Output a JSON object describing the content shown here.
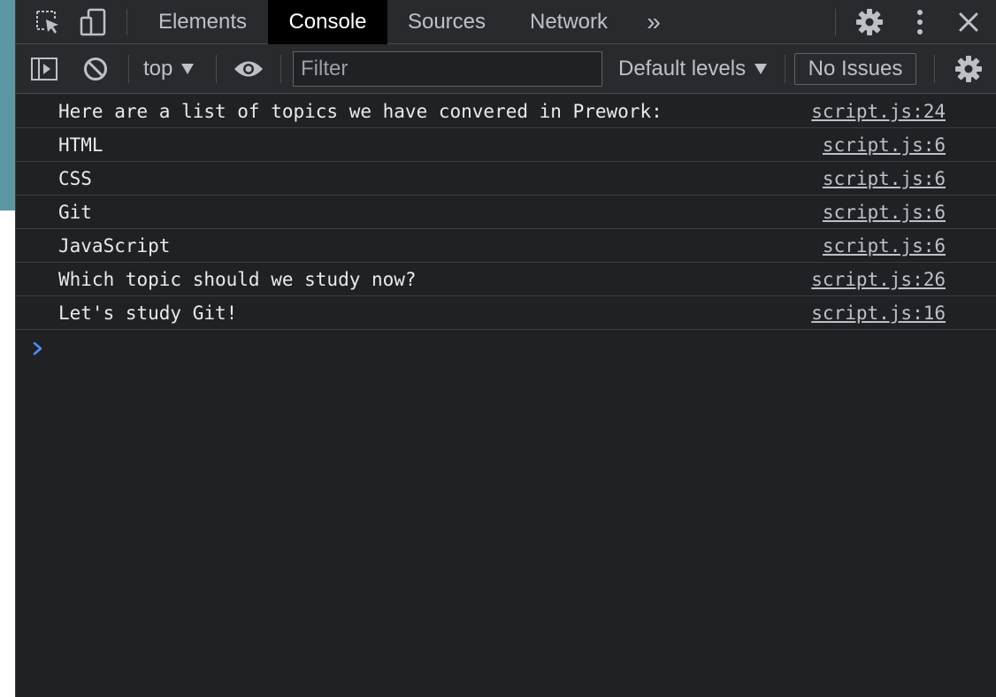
{
  "tabs": [
    {
      "label": "Elements",
      "active": false
    },
    {
      "label": "Console",
      "active": true
    },
    {
      "label": "Sources",
      "active": false
    },
    {
      "label": "Network",
      "active": false
    }
  ],
  "more_tabs_glyph": "»",
  "toolbar": {
    "context": "top",
    "filter_placeholder": "Filter",
    "levels": "Default levels",
    "issues": "No Issues"
  },
  "messages": [
    {
      "text": "Here are a list of topics we have convered in Prework:",
      "source": "script.js:24"
    },
    {
      "text": "HTML",
      "source": "script.js:6"
    },
    {
      "text": "CSS",
      "source": "script.js:6"
    },
    {
      "text": "Git",
      "source": "script.js:6"
    },
    {
      "text": "JavaScript",
      "source": "script.js:6"
    },
    {
      "text": "Which topic should we study now?",
      "source": "script.js:26"
    },
    {
      "text": "Let's study Git!",
      "source": "script.js:16"
    }
  ],
  "icons": {
    "inspect": "inspect-element-icon",
    "device": "device-toolbar-icon",
    "settings": "gear-icon",
    "menu": "kebab-menu-icon",
    "close": "close-icon",
    "sidebar": "sidebar-toggle-icon",
    "clear": "clear-console-icon",
    "eye": "eye-icon",
    "prompt": "chevron-right-icon"
  },
  "colors": {
    "background": "#202124",
    "toolbar": "#292a2d",
    "active_tab": "#000000",
    "prompt_accent": "#4d8df5",
    "page_strip": "#5c98a4"
  }
}
